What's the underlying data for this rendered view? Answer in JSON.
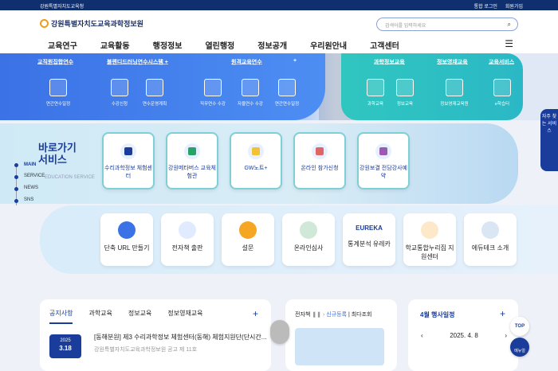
{
  "topbar": {
    "org": "강원특별자치도교육청",
    "login": "통합 로그인",
    "join": "회원가입"
  },
  "header": {
    "title": "강원특별자치도교육과학정보원",
    "search_placeholder": "검색어를 입력하세요"
  },
  "gnb": [
    "교육연구",
    "교육활동",
    "행정정보",
    "열린행정",
    "정보공개",
    "우리원안내",
    "고객센터"
  ],
  "sections": {
    "s1": "교직원집합연수",
    "s2": "블렌디드러닝연수시스템",
    "s3": "원격교육연수",
    "s4": "과학정보교육",
    "s5": "정보영재교육",
    "s6": "교육서비스"
  },
  "services": [
    "연간연수일정",
    "수강신청",
    "연수운영계획",
    "직무연수 수강",
    "자율연수 수강",
    "연간연수일정",
    "과학교육",
    "정보교육",
    "정보영재교육원",
    "e학습터"
  ],
  "quick": {
    "title1": "바로가기",
    "title2": "서비스",
    "main": "MAIN",
    "edu": "EDUCATION SERVICE",
    "nav": [
      "SERVICE",
      "NEWS",
      "SNS"
    ]
  },
  "cards1": [
    "수리과학정보 체험센터",
    "강원메타버스 교육체험관",
    "GW노트+",
    "온라인 참가신청",
    "강원보결 전담강사예약"
  ],
  "cards2": [
    "단축 URL 만들기",
    "전자책 출판",
    "설문",
    "온라인심사",
    "통계분석 유레카",
    "학교통합누리집 지원센터",
    "에듀테크 소개"
  ],
  "eureka": "EUREKA",
  "notice": {
    "tabs": [
      "공지사항",
      "과학교육",
      "정보교육",
      "정보영재교육"
    ],
    "year": "2025",
    "day": "3.18",
    "title": "[동해분원] 제3 수리과학정보 체험센터(동해) 체험지원단(단시간...",
    "sub": "강원특별자치도교육과학정보원 공고 제 11호"
  },
  "ebook": {
    "title": "전자책",
    "new": "신규등록",
    "view": "최다조회"
  },
  "schedule": {
    "title": "4월 행사일정",
    "date": "2025. 4. 8"
  },
  "float": {
    "top": "TOP",
    "manual": "메뉴얼",
    "sidetab": "자주 찾는 서비스"
  },
  "colors": {
    "primary": "#1a3c9a",
    "blue": "#3b72e6",
    "teal": "#30c6c0"
  }
}
